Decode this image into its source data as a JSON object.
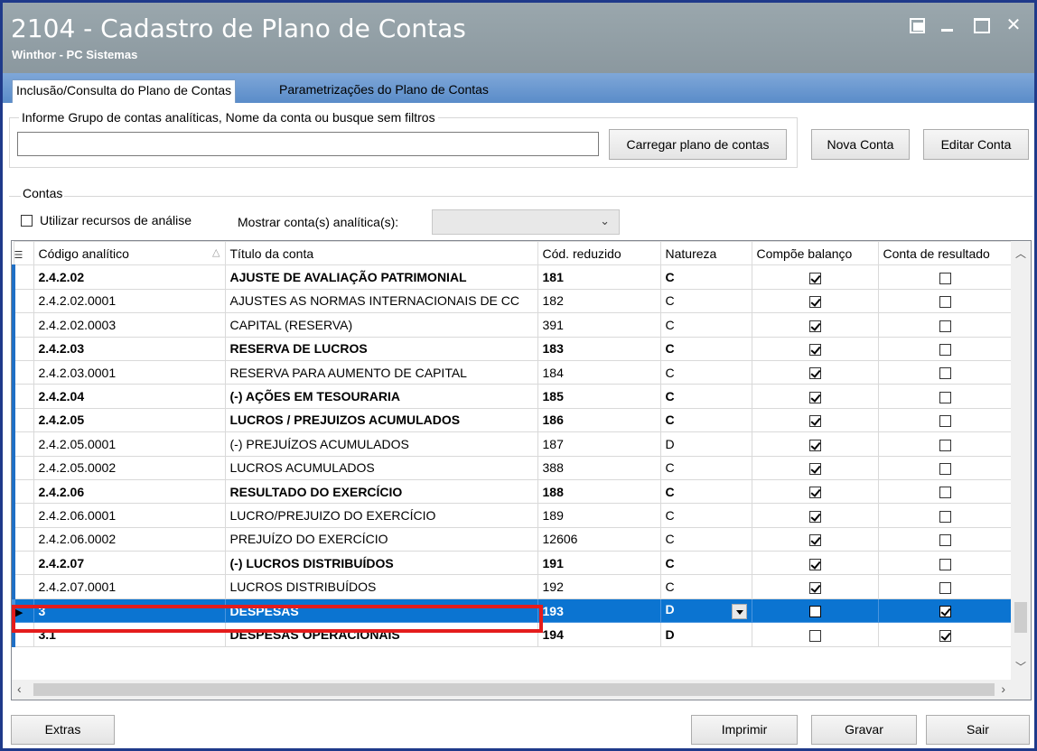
{
  "window": {
    "title": "2104 - Cadastro de Plano de Contas",
    "subtitle": "Winthor - PC Sistemas",
    "controls": [
      "restore-icon",
      "minimize-icon",
      "maximize-icon",
      "close-icon"
    ],
    "close_glyph": "✕"
  },
  "tabs": [
    {
      "label": "Inclusão/Consulta do Plano de Contas",
      "active": true
    },
    {
      "label": "Parametrizações do Plano de Contas",
      "active": false
    }
  ],
  "search": {
    "group_label": "Informe Grupo de contas analíticas, Nome da conta ou busque sem filtros",
    "value": "",
    "load_button": "Carregar plano de contas"
  },
  "actions": {
    "new_account": "Nova Conta",
    "edit_account": "Editar Conta"
  },
  "contas": {
    "label": "Contas",
    "use_analysis_label": "Utilizar recursos de análise",
    "use_analysis_checked": false,
    "show_analytic_label": "Mostrar conta(s) analítica(s):",
    "show_analytic_value": ""
  },
  "grid": {
    "columns": [
      "Código analítico",
      "Título da conta",
      "Cód. reduzido",
      "Natureza",
      "Compõe balanço",
      "Conta de resultado"
    ],
    "rows": [
      {
        "codigo": "2.4.2.02",
        "titulo": "AJUSTE DE AVALIAÇÃO PATRIMONIAL",
        "reduzido": "181",
        "natureza": "C",
        "balanco": true,
        "resultado": false,
        "bold": true,
        "selected": false
      },
      {
        "codigo": "2.4.2.02.0001",
        "titulo": "AJUSTES AS NORMAS INTERNACIONAIS DE CC",
        "reduzido": "182",
        "natureza": "C",
        "balanco": true,
        "resultado": false,
        "bold": false,
        "selected": false
      },
      {
        "codigo": "2.4.2.02.0003",
        "titulo": "CAPITAL (RESERVA)",
        "reduzido": "391",
        "natureza": "C",
        "balanco": true,
        "resultado": false,
        "bold": false,
        "selected": false
      },
      {
        "codigo": "2.4.2.03",
        "titulo": "RESERVA DE LUCROS",
        "reduzido": "183",
        "natureza": "C",
        "balanco": true,
        "resultado": false,
        "bold": true,
        "selected": false
      },
      {
        "codigo": "2.4.2.03.0001",
        "titulo": "RESERVA PARA AUMENTO DE CAPITAL",
        "reduzido": "184",
        "natureza": "C",
        "balanco": true,
        "resultado": false,
        "bold": false,
        "selected": false
      },
      {
        "codigo": "2.4.2.04",
        "titulo": "(-) AÇÕES EM TESOURARIA",
        "reduzido": "185",
        "natureza": "C",
        "balanco": true,
        "resultado": false,
        "bold": true,
        "selected": false
      },
      {
        "codigo": "2.4.2.05",
        "titulo": "LUCROS / PREJUIZOS ACUMULADOS",
        "reduzido": "186",
        "natureza": "C",
        "balanco": true,
        "resultado": false,
        "bold": true,
        "selected": false
      },
      {
        "codigo": "2.4.2.05.0001",
        "titulo": "(-) PREJUÍZOS ACUMULADOS",
        "reduzido": "187",
        "natureza": "D",
        "balanco": true,
        "resultado": false,
        "bold": false,
        "selected": false
      },
      {
        "codigo": "2.4.2.05.0002",
        "titulo": "LUCROS ACUMULADOS",
        "reduzido": "388",
        "natureza": "C",
        "balanco": true,
        "resultado": false,
        "bold": false,
        "selected": false
      },
      {
        "codigo": "2.4.2.06",
        "titulo": "RESULTADO DO EXERCÍCIO",
        "reduzido": "188",
        "natureza": "C",
        "balanco": true,
        "resultado": false,
        "bold": true,
        "selected": false
      },
      {
        "codigo": "2.4.2.06.0001",
        "titulo": "LUCRO/PREJUIZO DO EXERCÍCIO",
        "reduzido": "189",
        "natureza": "C",
        "balanco": true,
        "resultado": false,
        "bold": false,
        "selected": false
      },
      {
        "codigo": "2.4.2.06.0002",
        "titulo": "PREJUÍZO DO EXERCÍCIO",
        "reduzido": "12606",
        "natureza": "C",
        "balanco": true,
        "resultado": false,
        "bold": false,
        "selected": false
      },
      {
        "codigo": "2.4.2.07",
        "titulo": "(-) LUCROS DISTRIBUÍDOS",
        "reduzido": "191",
        "natureza": "C",
        "balanco": true,
        "resultado": false,
        "bold": true,
        "selected": false
      },
      {
        "codigo": "2.4.2.07.0001",
        "titulo": "LUCROS DISTRIBUÍDOS",
        "reduzido": "192",
        "natureza": "C",
        "balanco": true,
        "resultado": false,
        "bold": false,
        "selected": false
      },
      {
        "codigo": "3",
        "titulo": "DESPESAS",
        "reduzido": "193",
        "natureza": "D",
        "balanco": false,
        "resultado": true,
        "bold": true,
        "selected": true
      },
      {
        "codigo": "3.1",
        "titulo": "DESPESAS OPERACIONAIS",
        "reduzido": "194",
        "natureza": "D",
        "balanco": false,
        "resultado": true,
        "bold": true,
        "selected": false
      }
    ]
  },
  "footer": {
    "extras": "Extras",
    "print": "Imprimir",
    "save": "Gravar",
    "exit": "Sair"
  },
  "colors": {
    "title_bar": "#8b989f",
    "tab_strip": "#5a8cc9",
    "selection": "#0b74d1",
    "highlight_box": "#e41c1c",
    "window_border": "#1f3a8a"
  }
}
